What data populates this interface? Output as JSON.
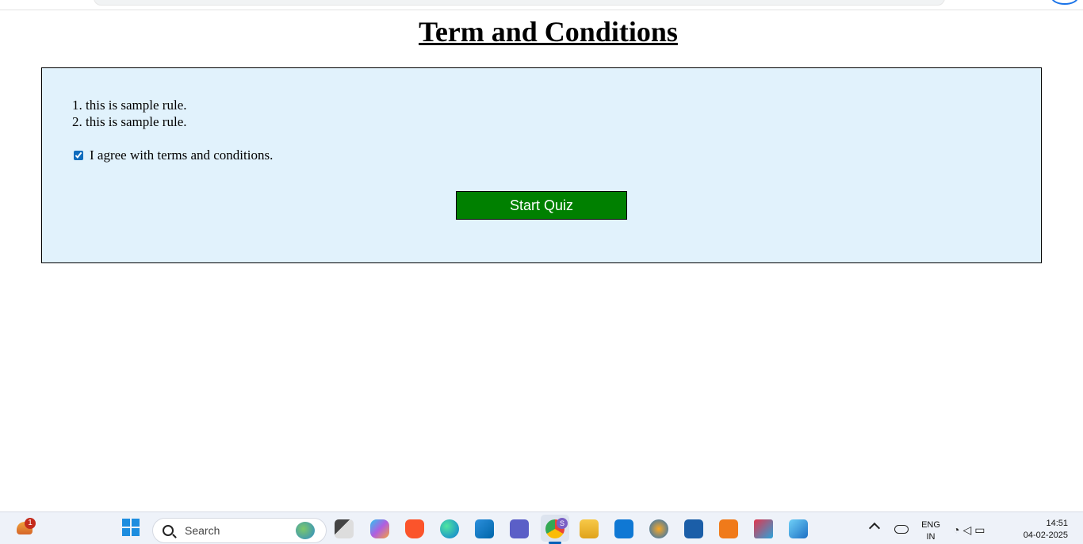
{
  "page": {
    "title": "Term and Conditions",
    "rules": [
      "this is sample rule.",
      "this is sample rule."
    ],
    "agree_label": "I agree with terms and conditions.",
    "agree_checked": true,
    "start_button": "Start Quiz"
  },
  "taskbar": {
    "weather_badge": "1",
    "search_label": "Search",
    "chrome_profile_badge": "S",
    "language": "ENG",
    "region": "IN",
    "time": "14:51",
    "date": "04-02-2025"
  },
  "colors": {
    "panel_bg": "#e1f2fc",
    "button_bg": "#008000"
  }
}
